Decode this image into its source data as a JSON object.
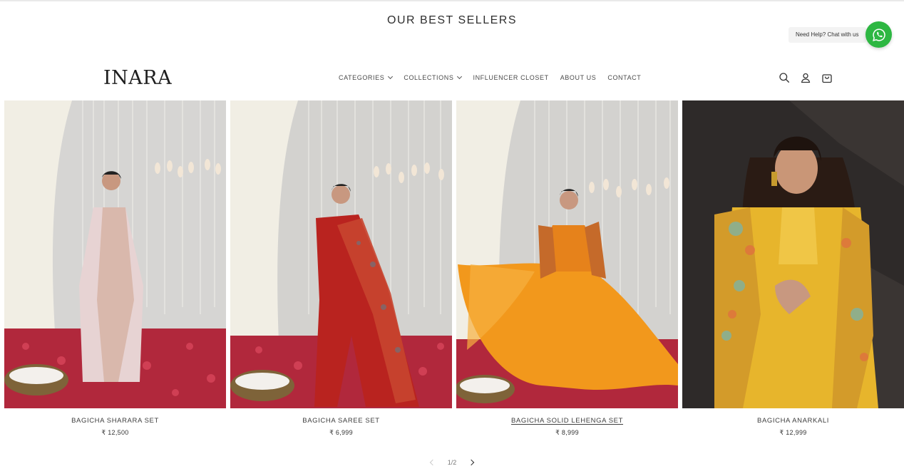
{
  "section": {
    "title": "OUR BEST SELLERS"
  },
  "chat": {
    "label": "Need Help? Chat with us",
    "icon": "whatsapp-icon",
    "color": "#2db742"
  },
  "brand": {
    "logo": "INARA"
  },
  "nav": {
    "items": [
      {
        "label": "CATEGORIES",
        "dropdown": true
      },
      {
        "label": "COLLECTIONS",
        "dropdown": true
      },
      {
        "label": "INFLUENCER CLOSET",
        "dropdown": false
      },
      {
        "label": "ABOUT US",
        "dropdown": false
      },
      {
        "label": "CONTACT",
        "dropdown": false
      }
    ]
  },
  "header_icons": [
    "search-icon",
    "account-icon",
    "cart-icon"
  ],
  "products": [
    {
      "name": "BAGICHA SHARARA SET",
      "price": "₹ 12,500"
    },
    {
      "name": "BAGICHA SAREE SET",
      "price": "₹ 6,999"
    },
    {
      "name": "BAGICHA SOLID LEHENGA SET",
      "price": "₹ 8,999"
    },
    {
      "name": "BAGICHA ANARKALI",
      "price": "₹ 12,999"
    }
  ],
  "pagination": {
    "current": "1/2"
  }
}
